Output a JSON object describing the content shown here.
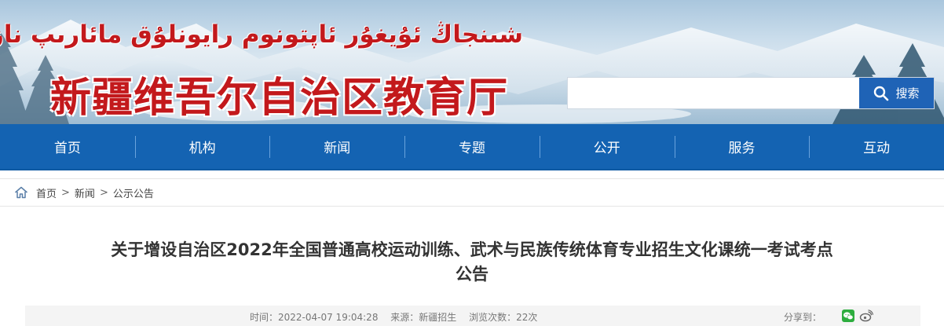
{
  "header": {
    "uyghur_title": "شىنجاڭ ئۇيغۇر ئاپتونوم رايونلۇق مائارىپ نازارىتى",
    "chinese_title": "新疆维吾尔自治区教育厅"
  },
  "search": {
    "placeholder": "",
    "value": "",
    "button_label": "搜索"
  },
  "nav": {
    "items": [
      {
        "label": "首页"
      },
      {
        "label": "机构"
      },
      {
        "label": "新闻"
      },
      {
        "label": "专题"
      },
      {
        "label": "公开"
      },
      {
        "label": "服务"
      },
      {
        "label": "互动"
      }
    ]
  },
  "breadcrumb": {
    "items": [
      {
        "label": "首页"
      },
      {
        "label": "新闻"
      },
      {
        "label": "公示公告"
      }
    ],
    "separator": ">"
  },
  "article": {
    "title_line1": "关于增设自治区2022年全国普通高校运动训练、武术与民族传统体育专业招生文化课统一考试考点",
    "title_line2": "公告",
    "time": "时间：2022-04-07 19:04:28",
    "source": "来源：新疆招生",
    "views": "浏览次数：22次",
    "share_label": "分享到："
  },
  "colors": {
    "brand_red": "#c3191c",
    "nav_blue": "#1463b2",
    "search_button": "#1f63b6"
  }
}
